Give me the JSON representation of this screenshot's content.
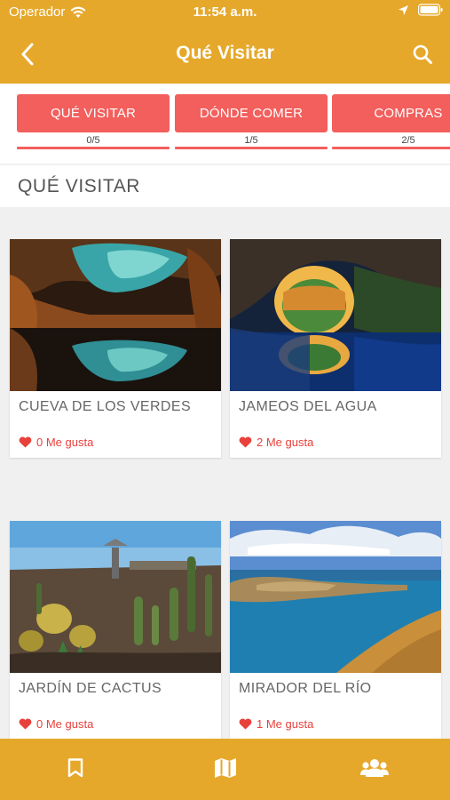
{
  "status_bar": {
    "carrier": "Operador",
    "time": "11:54 a.m."
  },
  "nav": {
    "title": "Qué Visitar",
    "back_icon": "chevron-left-icon",
    "search_icon": "search-icon"
  },
  "category_tabs": [
    {
      "label": "QUÉ VISITAR",
      "progress": "0/5"
    },
    {
      "label": "DÓNDE COMER",
      "progress": "1/5"
    },
    {
      "label": "COMPRAS",
      "progress": "2/5"
    }
  ],
  "section": {
    "title": "QUÉ VISITAR"
  },
  "places": [
    {
      "name": "CUEVA DE LOS VERDES",
      "likes": "0 Me gusta"
    },
    {
      "name": "JAMEOS DEL AGUA",
      "likes": "2 Me gusta"
    },
    {
      "name": "JARDÍN DE CACTUS",
      "likes": "0 Me gusta"
    },
    {
      "name": "MIRADOR DEL RÍO",
      "likes": "1 Me gusta"
    }
  ],
  "bottom_tabs": [
    {
      "icon": "bookmark-icon"
    },
    {
      "icon": "map-icon"
    },
    {
      "icon": "people-icon"
    }
  ],
  "colors": {
    "primary": "#e6a82a",
    "accent": "#f25f5c",
    "like": "#e8413c"
  }
}
